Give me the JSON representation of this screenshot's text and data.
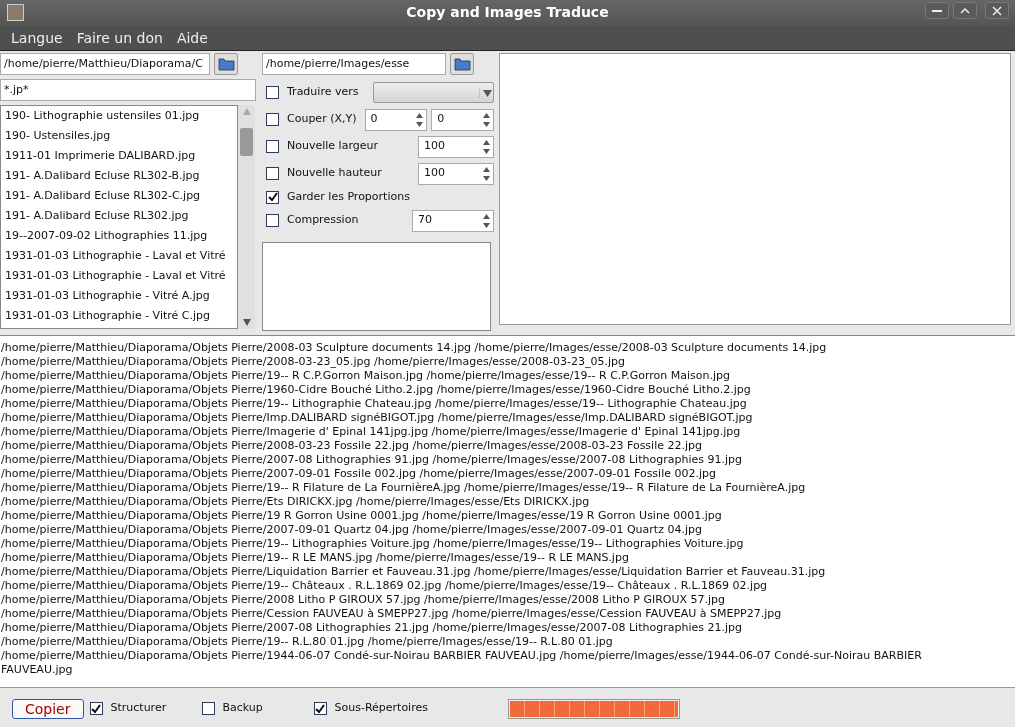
{
  "window": {
    "title": "Copy and Images Traduce"
  },
  "menu": [
    "Langue",
    "Faire un don",
    "Aide"
  ],
  "source": {
    "path": "/home/pierre/Matthieu/Diaporama/C",
    "filter": "*.jp*"
  },
  "files": [
    "190- Lithographie ustensiles 01.jpg",
    "190- Ustensiles.jpg",
    "1911-01 Imprimerie DALIBARD.jpg",
    "191- A.Dalibard Ecluse RL302-B.jpg",
    "191- A.Dalibard Ecluse RL302-C.jpg",
    "191- A.Dalibard Ecluse RL302.jpg",
    "19--2007-09-02 Lithographies 11.jpg",
    "1931-01-03 Lithographie - Laval et Vitré",
    "1931-01-03 Lithographie - Laval et Vitré",
    "1931-01-03 Lithographie - Vitré A.jpg",
    "1931-01-03 Lithographie - Vitré C.jpg"
  ],
  "destination": {
    "path": "/home/pierre/Images/esse"
  },
  "options": [
    {
      "kind": "combo",
      "label": "Traduire vers",
      "checked": false
    },
    {
      "kind": "pair",
      "label": "Couper (X,Y)",
      "checked": false,
      "values": [
        "0",
        "0"
      ]
    },
    {
      "kind": "spin",
      "label": "Nouvelle largeur",
      "checked": false,
      "value": "100"
    },
    {
      "kind": "spin",
      "label": "Nouvelle hauteur",
      "checked": false,
      "value": "100"
    },
    {
      "kind": "check",
      "label": "Garder les Proportions",
      "checked": true
    },
    {
      "kind": "spin",
      "label": "Compression",
      "checked": false,
      "value": "70"
    }
  ],
  "log": [
    "/home/pierre/Matthieu/Diaporama/Objets Pierre/2008-03 Sculpture documents 14.jpg  /home/pierre/Images/esse/2008-03 Sculpture documents 14.jpg",
    "/home/pierre/Matthieu/Diaporama/Objets Pierre/2008-03-23_05.jpg  /home/pierre/Images/esse/2008-03-23_05.jpg",
    "/home/pierre/Matthieu/Diaporama/Objets Pierre/19-- R C.P.Gorron Maison.jpg  /home/pierre/Images/esse/19-- R C.P.Gorron Maison.jpg",
    "/home/pierre/Matthieu/Diaporama/Objets Pierre/1960-Cidre Bouché Litho.2.jpg  /home/pierre/Images/esse/1960-Cidre Bouché Litho.2.jpg",
    "/home/pierre/Matthieu/Diaporama/Objets Pierre/19-- Lithographie Chateau.jpg  /home/pierre/Images/esse/19-- Lithographie Chateau.jpg",
    "/home/pierre/Matthieu/Diaporama/Objets Pierre/Imp.DALIBARD signéBIGOT.jpg  /home/pierre/Images/esse/Imp.DALIBARD signéBIGOT.jpg",
    "/home/pierre/Matthieu/Diaporama/Objets Pierre/Imagerie d' Epinal 141jpg.jpg  /home/pierre/Images/esse/Imagerie d' Epinal 141jpg.jpg",
    "/home/pierre/Matthieu/Diaporama/Objets Pierre/2008-03-23 Fossile 22.jpg  /home/pierre/Images/esse/2008-03-23 Fossile 22.jpg",
    "/home/pierre/Matthieu/Diaporama/Objets Pierre/2007-08 Lithographies 91.jpg  /home/pierre/Images/esse/2007-08 Lithographies 91.jpg",
    "/home/pierre/Matthieu/Diaporama/Objets Pierre/2007-09-01 Fossile 002.jpg  /home/pierre/Images/esse/2007-09-01 Fossile 002.jpg",
    "/home/pierre/Matthieu/Diaporama/Objets Pierre/19-- R Filature de La FournièreA.jpg  /home/pierre/Images/esse/19-- R Filature de La FournièreA.jpg",
    "/home/pierre/Matthieu/Diaporama/Objets Pierre/Ets DIRICKX.jpg  /home/pierre/Images/esse/Ets DIRICKX.jpg",
    "/home/pierre/Matthieu/Diaporama/Objets Pierre/19 R Gorron Usine 0001.jpg  /home/pierre/Images/esse/19 R Gorron Usine 0001.jpg",
    "/home/pierre/Matthieu/Diaporama/Objets Pierre/2007-09-01 Quartz 04.jpg  /home/pierre/Images/esse/2007-09-01 Quartz 04.jpg",
    "/home/pierre/Matthieu/Diaporama/Objets Pierre/19-- Lithographies Voiture.jpg  /home/pierre/Images/esse/19-- Lithographies Voiture.jpg",
    "/home/pierre/Matthieu/Diaporama/Objets Pierre/19-- R LE MANS.jpg  /home/pierre/Images/esse/19-- R LE MANS.jpg",
    "/home/pierre/Matthieu/Diaporama/Objets Pierre/Liquidation Barrier et Fauveau.31.jpg  /home/pierre/Images/esse/Liquidation Barrier et Fauveau.31.jpg",
    "/home/pierre/Matthieu/Diaporama/Objets Pierre/19-- Châteaux . R.L.1869 02.jpg  /home/pierre/Images/esse/19-- Châteaux . R.L.1869 02.jpg",
    "/home/pierre/Matthieu/Diaporama/Objets Pierre/2008 Litho P GIROUX 57.jpg  /home/pierre/Images/esse/2008 Litho P GIROUX 57.jpg",
    "/home/pierre/Matthieu/Diaporama/Objets Pierre/Cession FAUVEAU à SMEPP27.jpg  /home/pierre/Images/esse/Cession FAUVEAU à SMEPP27.jpg",
    "/home/pierre/Matthieu/Diaporama/Objets Pierre/2007-08 Lithographies 21.jpg  /home/pierre/Images/esse/2007-08 Lithographies 21.jpg",
    "/home/pierre/Matthieu/Diaporama/Objets Pierre/19-- R.L.80 01.jpg  /home/pierre/Images/esse/19-- R.L.80 01.jpg",
    "/home/pierre/Matthieu/Diaporama/Objets Pierre/1944-06-07 Condé-sur-Noirau BARBIER FAUVEAU.jpg  /home/pierre/Images/esse/1944-06-07 Condé-sur-Noirau BARBIER FAUVEAU.jpg"
  ],
  "bottom": {
    "button": "Copier",
    "checks": [
      {
        "label": "Structurer",
        "checked": true
      },
      {
        "label": "Backup",
        "checked": false
      },
      {
        "label": "Sous-Répertoires",
        "checked": true
      }
    ],
    "progress": {
      "level": 1
    }
  }
}
